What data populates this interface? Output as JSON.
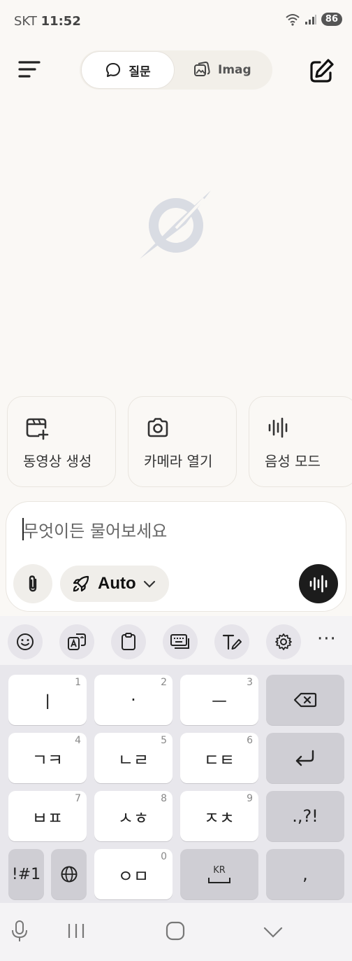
{
  "status_bar": {
    "carrier": "SKT",
    "time": "11:52",
    "battery": "86"
  },
  "header": {
    "tab_ask": "질문",
    "tab_image": "Imag"
  },
  "quick_actions": [
    {
      "label": "동영상 생성",
      "icon": "video-add-icon"
    },
    {
      "label": "카메라 열기",
      "icon": "camera-icon"
    },
    {
      "label": "음성 모드",
      "icon": "voice-wave-icon"
    }
  ],
  "composer": {
    "placeholder": "무엇이든 물어보세요",
    "model": "Auto"
  },
  "keyboard": {
    "rows": [
      [
        {
          "label": "ㅣ",
          "hint": "1"
        },
        {
          "label": "·",
          "hint": "2"
        },
        {
          "label": "ㅡ",
          "hint": "3"
        }
      ],
      [
        {
          "label": "ㄱㅋ",
          "hint": "4"
        },
        {
          "label": "ㄴㄹ",
          "hint": "5"
        },
        {
          "label": "ㄷㅌ",
          "hint": "6"
        }
      ],
      [
        {
          "label": "ㅂㅍ",
          "hint": "7"
        },
        {
          "label": "ㅅㅎ",
          "hint": "8"
        },
        {
          "label": "ㅈㅊ",
          "hint": "9"
        }
      ]
    ],
    "symbols": "!#1",
    "zero_key": "ㅇㅁ",
    "zero_hint": "0",
    "space_lang": "KR",
    "punct": ".,?!",
    "comma": ",",
    "more": "···"
  }
}
